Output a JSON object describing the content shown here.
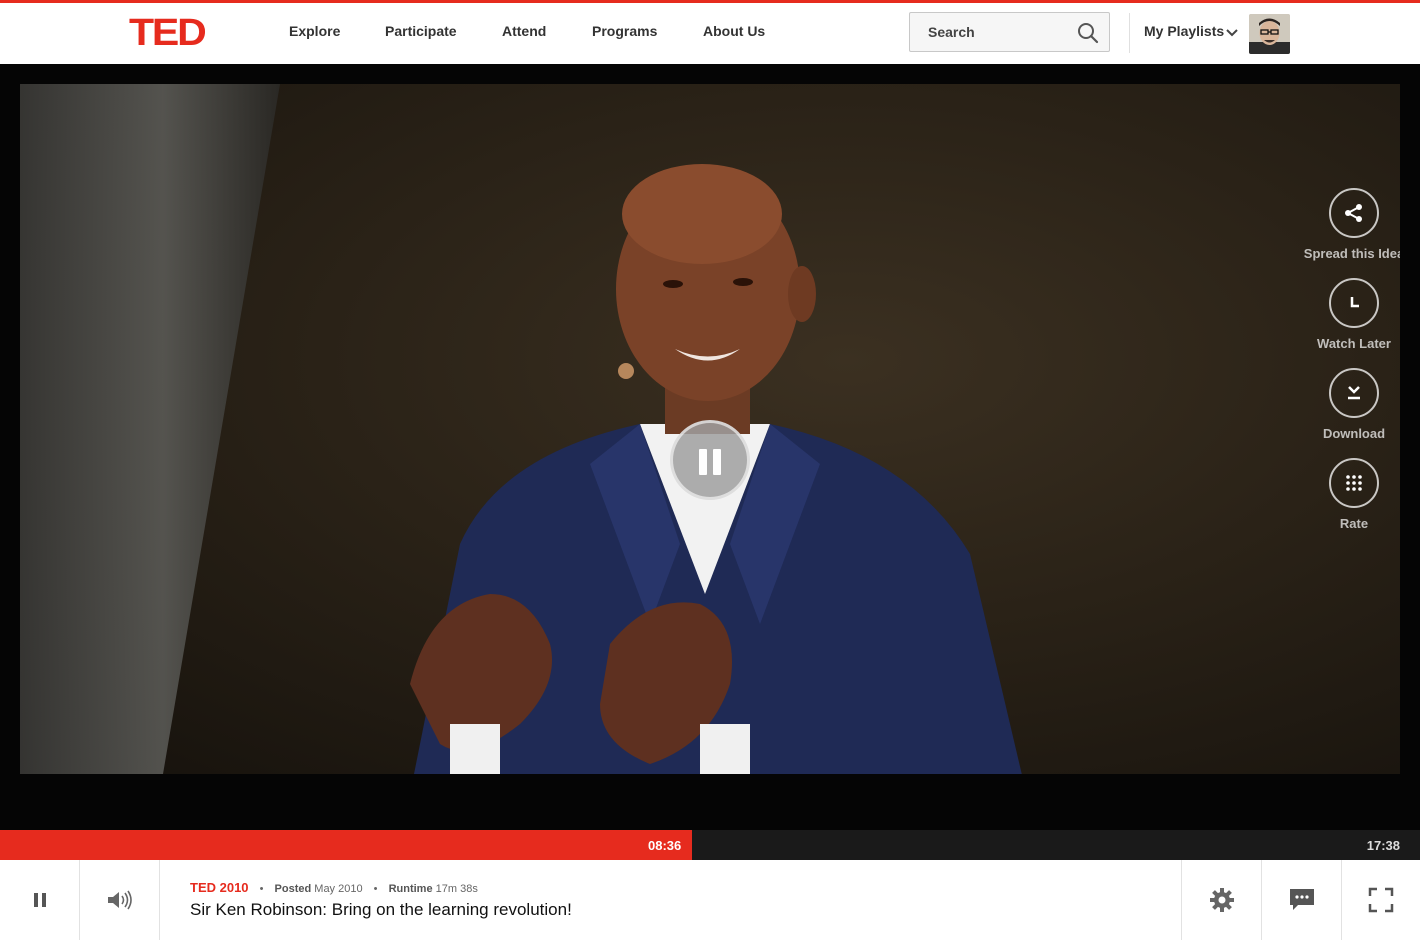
{
  "header": {
    "logo": "TED",
    "nav": [
      "Explore",
      "Participate",
      "Attend",
      "Programs",
      "About Us"
    ],
    "search_placeholder": "Search",
    "playlists_label": "My Playlists"
  },
  "video": {
    "side_actions": [
      {
        "label": "Spread this Idea",
        "icon": "share-icon"
      },
      {
        "label": "Watch Later",
        "icon": "clock-icon"
      },
      {
        "label": "Download",
        "icon": "download-icon"
      },
      {
        "label": "Rate",
        "icon": "grid-icon"
      }
    ],
    "state": "playing"
  },
  "progress": {
    "current_time": "08:36",
    "total_time": "17:38",
    "fraction": 0.487
  },
  "info": {
    "event": "TED 2010",
    "posted_label": "Posted",
    "posted_value": "May 2010",
    "runtime_label": "Runtime",
    "runtime_value": "17m 38s",
    "title": "Sir Ken Robinson: Bring on the learning revolution!"
  },
  "colors": {
    "accent": "#e62b1e",
    "text": "#333333"
  }
}
